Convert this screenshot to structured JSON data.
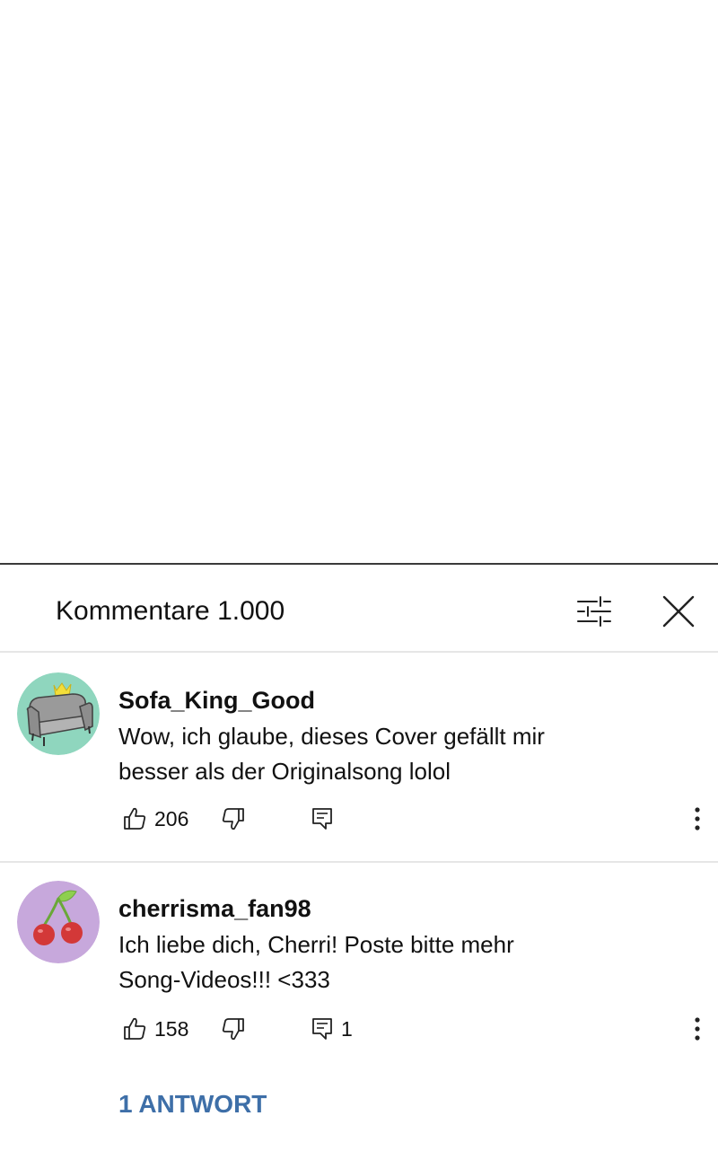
{
  "panel": {
    "title": "Kommentare 1.000"
  },
  "comments": [
    {
      "username": "Sofa_King_Good",
      "text": "Wow, ich glaube, dieses Cover gefällt mir besser als der Originalsong lolol",
      "likes": "206",
      "avatar_icon": "armchair-with-crown-icon",
      "avatar_bg": "#8fd6be"
    },
    {
      "username": "cherrisma_fan98",
      "text": "Ich liebe dich, Cherri! Poste bitte mehr Song-Videos!!! <333",
      "likes": "158",
      "replies_count": "1",
      "replies_link": "1 ANTWORT",
      "avatar_icon": "cherries-icon",
      "avatar_bg": "#c7a8dc"
    }
  ],
  "colors": {
    "link": "#3e6fa8",
    "divider": "#e6e6e6"
  }
}
